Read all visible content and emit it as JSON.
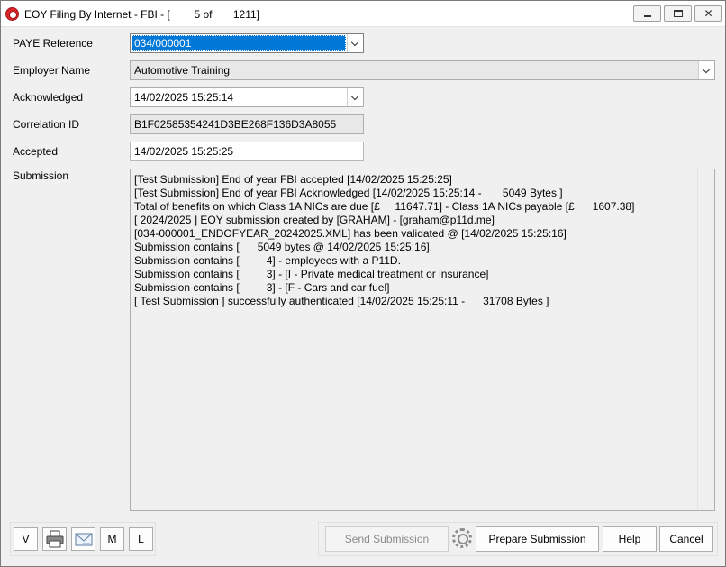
{
  "window": {
    "title": "EOY Filing By Internet - FBI - [        5 of       1211]"
  },
  "form": {
    "paye_reference_label": "PAYE Reference",
    "paye_reference_value": "034/000001",
    "employer_name_label": "Employer Name",
    "employer_name_value": "Automotive Training",
    "acknowledged_label": "Acknowledged",
    "acknowledged_value": "14/02/2025 15:25:14",
    "correlation_id_label": "Correlation ID",
    "correlation_id_value": "B1F02585354241D3BE268F136D3A8055",
    "accepted_label": "Accepted",
    "accepted_value": "14/02/2025 15:25:25",
    "submission_label": "Submission"
  },
  "submission_lines": [
    "[Test Submission] End of year FBI accepted [14/02/2025 15:25:25]",
    "[Test Submission] End of year FBI Acknowledged [14/02/2025 15:25:14 -       5049 Bytes ]",
    "Total of benefits on which Class 1A NICs are due [£     11647.71] - Class 1A NICs payable [£      1607.38]",
    "[ 2024/2025 ] EOY submission created by [GRAHAM] - [graham@p11d.me]",
    "[034-000001_ENDOFYEAR_20242025.XML] has been validated @ [14/02/2025 15:25:16]",
    "Submission contains [      5049 bytes @ 14/02/2025 15:25:16].",
    "Submission contains [         4] - employees with a P11D.",
    "Submission contains [         3] - [I - Private medical treatment or insurance]",
    "Submission contains [         3] - [F - Cars and car fuel]",
    "[ Test Submission ] successfully authenticated [14/02/2025 15:25:11 -      31708 Bytes ]"
  ],
  "toolbar": {
    "v_label": "V",
    "m_label": "M",
    "l_label": "L",
    "print_icon": "printer-icon",
    "email_icon": "email-icon"
  },
  "buttons": {
    "send_submission": "Send Submission",
    "prepare_submission": "Prepare Submission",
    "help": "Help",
    "cancel": "Cancel"
  },
  "colors": {
    "selection": "#0078d7",
    "background": "#f0f0f0"
  }
}
